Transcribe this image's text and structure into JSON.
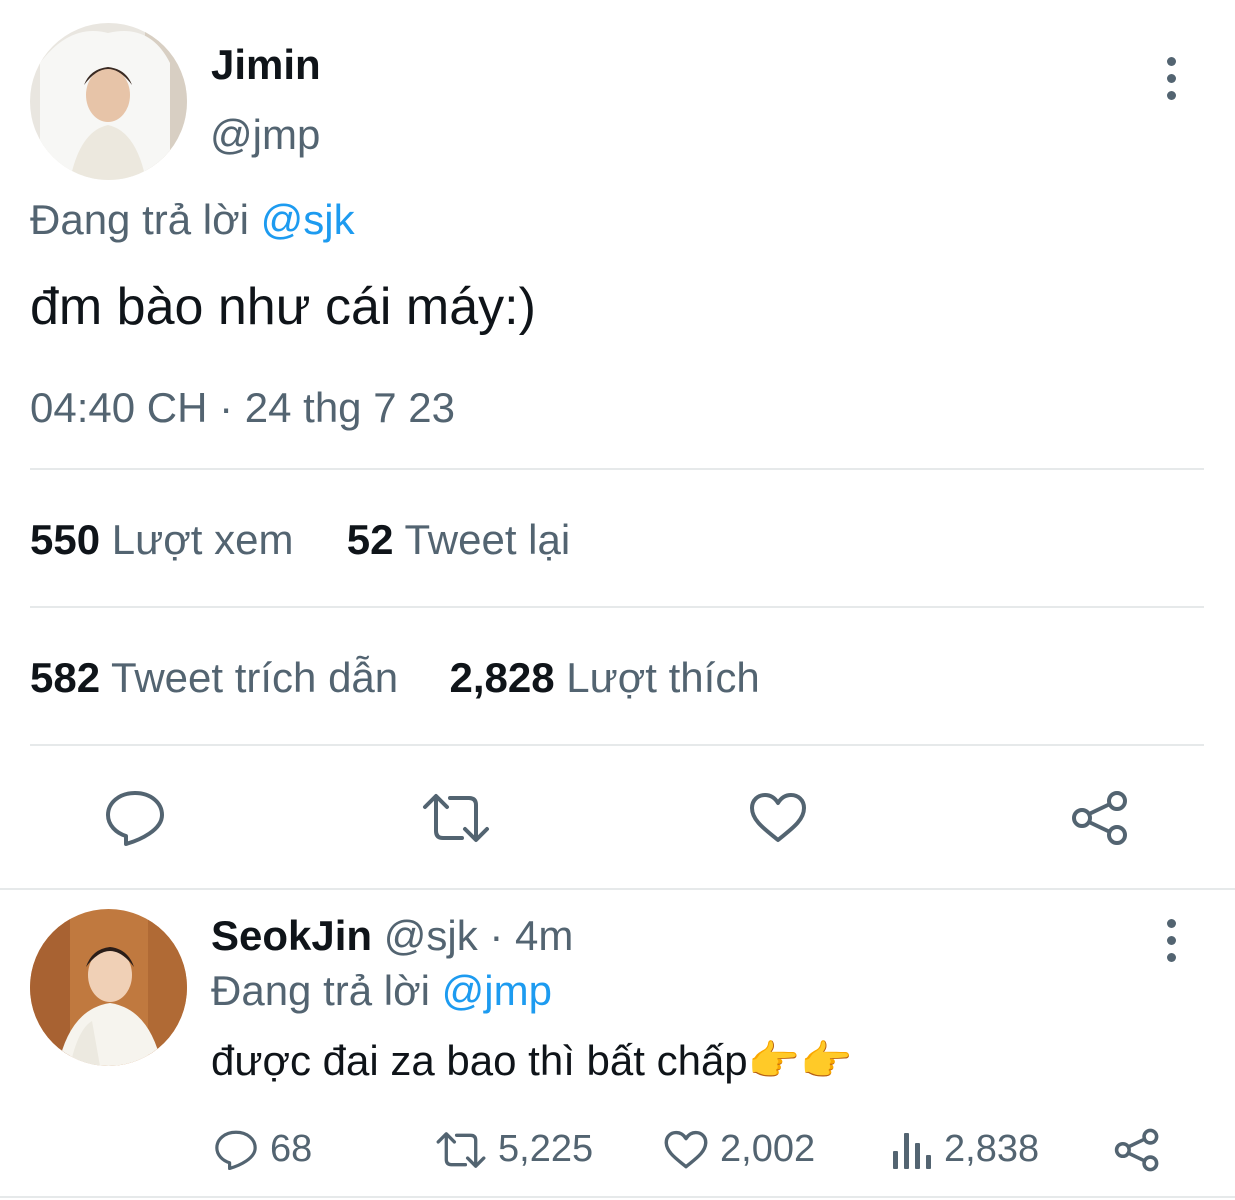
{
  "main_tweet": {
    "display_name": "Jimin",
    "handle": "@jmp",
    "replying_prefix": "Đang trả lời",
    "replying_to": "@sjk",
    "text": "đm bào như cái máy:)",
    "timestamp": "04:40 CH · 24 thg 7 23",
    "stats": {
      "views_count": "550",
      "views_label": "Lượt xem",
      "retweets_count": "52",
      "retweets_label": "Tweet lại",
      "quotes_count": "582",
      "quotes_label": "Tweet trích dẫn",
      "likes_count": "2,828",
      "likes_label": "Lượt thích"
    },
    "actions": [
      "reply-icon",
      "retweet-icon",
      "like-icon",
      "share-icon"
    ]
  },
  "reply_tweet": {
    "display_name": "SeokJin",
    "handle": "@sjk",
    "time_ago": "· 4m",
    "replying_prefix": "Đang trả lời",
    "replying_to": "@jmp",
    "text": "được đai za bao thì bất chấp",
    "emojis": "👉👉",
    "replies": "68",
    "retweets": "5,225",
    "likes": "2,002",
    "views": "2,838"
  },
  "colors": {
    "accent": "#1d9bf0",
    "secondary_text": "#536471",
    "divider": "#e6e9ea"
  }
}
